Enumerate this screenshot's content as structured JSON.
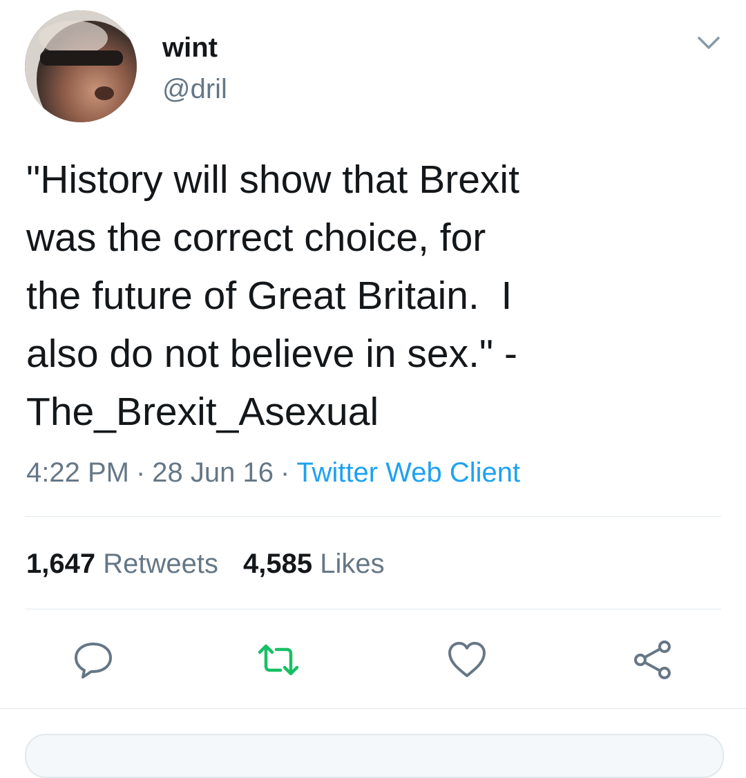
{
  "tweet": {
    "author": {
      "display_name": "wint",
      "handle": "@dril"
    },
    "text": "\"History will show that Brexit\nwas the correct choice, for\nthe future of Great Britain.  I\nalso do not believe in sex.\" -\nThe_Brexit_Asexual",
    "time": "4:22 PM",
    "date": "28 Jun 16",
    "separator": "·",
    "client": "Twitter Web Client",
    "stats": {
      "retweets_count": "1,647",
      "retweets_label": "Retweets",
      "likes_count": "4,585",
      "likes_label": "Likes"
    },
    "actions": [
      "reply-icon",
      "retweet-icon",
      "like-icon",
      "share-icon"
    ]
  },
  "colors": {
    "text": "#14171a",
    "secondary": "#657786",
    "link": "#1da1f2",
    "retweet": "#17bf63",
    "divider": "#e1e8ed"
  }
}
